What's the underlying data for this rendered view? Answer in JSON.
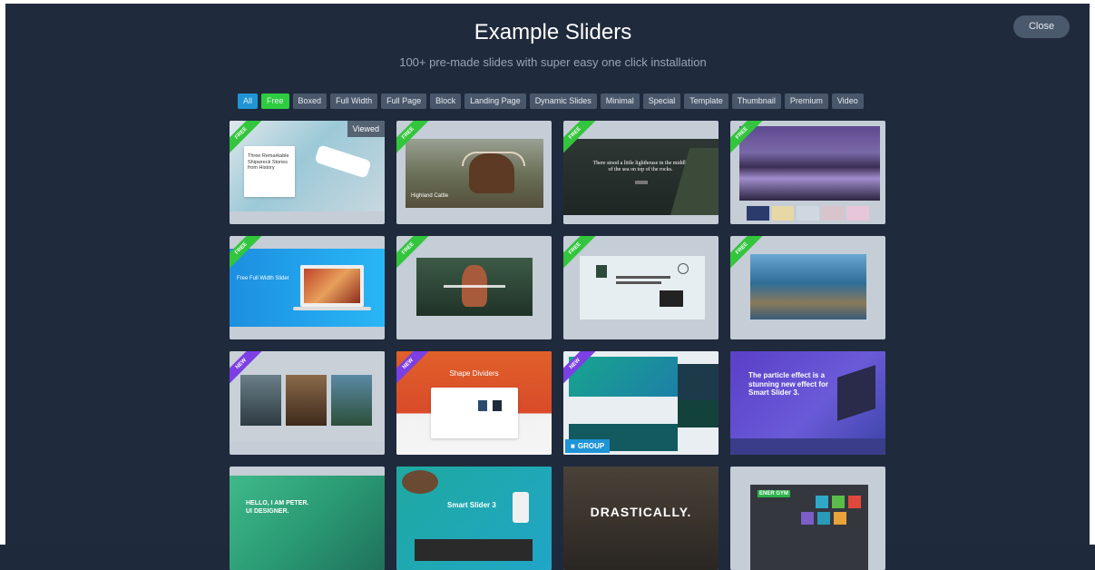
{
  "header": {
    "title": "Example Sliders",
    "subtitle": "100+ pre-made slides with super easy one click installation",
    "close_label": "Close"
  },
  "filters": [
    "All",
    "Free",
    "Boxed",
    "Full Width",
    "Full Page",
    "Block",
    "Landing Page",
    "Dynamic Slides",
    "Minimal",
    "Special",
    "Template",
    "Thumbnail",
    "Premium",
    "Video"
  ],
  "cards": [
    {
      "ribbon": "FREE",
      "viewed": "Viewed",
      "caption": "Three Remarkable Shipwreck Stories from History"
    },
    {
      "ribbon": "FREE",
      "caption": "Highland Cattle"
    },
    {
      "ribbon": "FREE",
      "caption": "There stood a little lighthouse in the middle of the sea on top of the rocks."
    },
    {
      "ribbon": "FREE"
    },
    {
      "ribbon": "FREE",
      "caption": "Free Full Width Slider"
    },
    {
      "ribbon": "FREE"
    },
    {
      "ribbon": "FREE"
    },
    {
      "ribbon": "FREE"
    },
    {
      "ribbon": "NEW"
    },
    {
      "ribbon": "NEW",
      "caption": "Shape Dividers"
    },
    {
      "ribbon": "NEW",
      "badge": "GROUP"
    },
    {
      "caption": "The particle effect is a stunning new effect for Smart Slider 3."
    },
    {
      "caption": "HELLO, I AM PETER. UI DESIGNER."
    },
    {
      "caption": "Smart Slider 3"
    },
    {
      "caption": "DRASTICALLY."
    },
    {
      "caption": "ENER GYM"
    }
  ],
  "colors": {
    "background": "#1f2a3c",
    "all_chip": "#1f95d6",
    "free_chip": "#2ecc40",
    "free_ribbon": "#33c53d",
    "new_ribbon": "#7b3fe4"
  }
}
